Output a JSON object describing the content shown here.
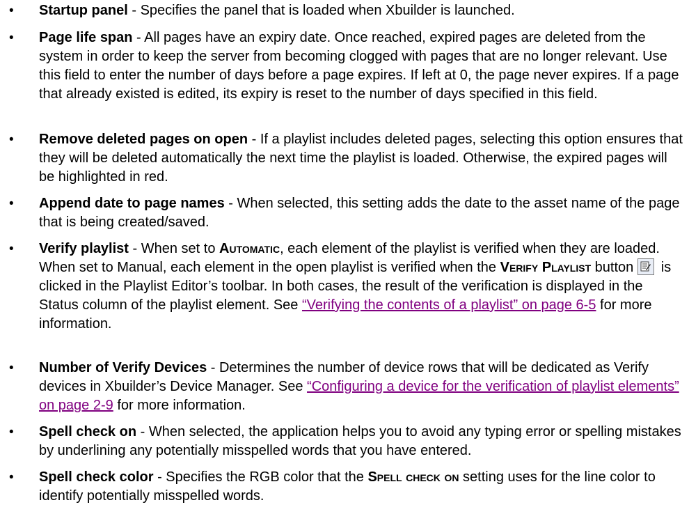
{
  "items": [
    {
      "term": "Startup panel",
      "desc": " - Specifies the panel that is loaded when Xbuilder is launched."
    },
    {
      "term": "Page life span",
      "desc": " - All pages have an expiry date. Once reached, expired pages are deleted from the system in order to keep the server from becoming clogged with pages that are no longer relevant. Use this field to enter the number of days before a page expires. If left at 0, the page never expires. If a page that already existed is edited, its expiry is reset to the number of days specified in this field."
    },
    {
      "term": "Remove deleted pages on open",
      "desc": " - If a playlist includes deleted pages, selecting this option ensures that they will be deleted automatically the next time the playlist is loaded. Otherwise, the expired pages will be highlighted in red."
    },
    {
      "term": "Append date to page names",
      "desc": " - When selected, this setting adds the date to the asset name of the page that is being created/saved."
    },
    {
      "term": "Verify playlist",
      "t1": " - When set to ",
      "sc1": "Automatic",
      "t2": ", each element of the playlist is verified when they are loaded. When set to Manual, each element in the open playlist is verified when the ",
      "sc2": "Verify Playlist",
      "t3": " button",
      "t4": " is clicked in the Playlist Editor’s toolbar. In both cases, the result of the verification is displayed in the Status column of the playlist element. See ",
      "link": "“Verifying the contents of a playlist” on page 6-5",
      "t5": " for more information."
    },
    {
      "term": "Number of Verify Devices",
      "t1": " - Determines the number of device rows that will be dedicated as Verify devices in Xbuilder’s Device Manager. See ",
      "link": "“Configuring a device for the verification of playlist elements” on page 2-9",
      "t2": " for more information."
    },
    {
      "term": "Spell check on",
      "desc": " - When selected, the application helps you to avoid any typing error or spelling mistakes by underlining any potentially misspelled words that you have entered."
    },
    {
      "term": "Spell check color",
      "t1": " - Specifies the RGB color that the ",
      "sc1": "Spell check on",
      "t2": " setting uses for the line color to identify potentially misspelled words."
    }
  ],
  "bullet_char": "•",
  "link_color": "#800080"
}
